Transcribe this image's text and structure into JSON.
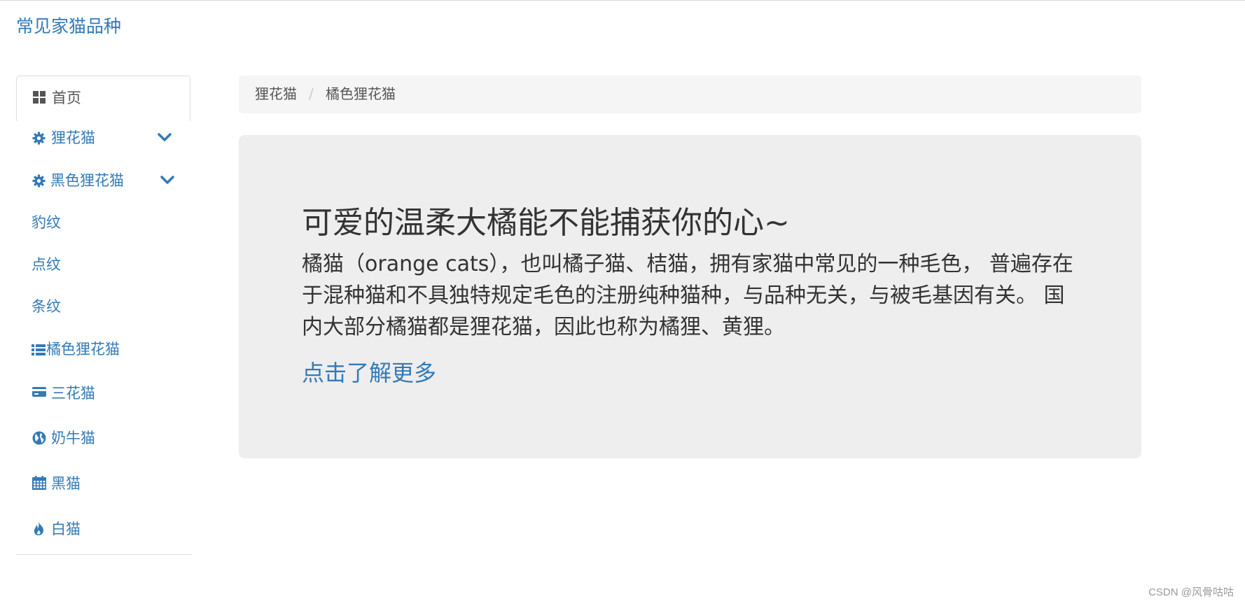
{
  "header": {
    "brand": "常见家猫品种"
  },
  "sidebar": {
    "home": {
      "label": "首页",
      "icon": "grid-icon"
    },
    "items": [
      {
        "label": "狸花猫",
        "icon": "gear-icon",
        "has_dropdown": true
      },
      {
        "label": "黑色狸花猫",
        "icon": "gear-icon",
        "has_dropdown": true
      },
      {
        "label": "豹纹",
        "icon": ""
      },
      {
        "label": "点纹",
        "icon": ""
      },
      {
        "label": "条纹",
        "icon": ""
      },
      {
        "label": "橘色狸花猫",
        "icon": "list-icon"
      },
      {
        "label": "三花猫",
        "icon": "credit-card-icon"
      },
      {
        "label": "奶牛猫",
        "icon": "globe-icon"
      },
      {
        "label": "黑猫",
        "icon": "calendar-icon"
      },
      {
        "label": "白猫",
        "icon": "fire-icon"
      }
    ]
  },
  "breadcrumb": {
    "items": [
      "狸花猫",
      "橘色狸花猫"
    ],
    "separator": "/"
  },
  "jumbotron": {
    "title": "可爱的温柔大橘能不能捕获你的心~",
    "text": "橘猫（orange cats），也叫橘子猫、桔猫，拥有家猫中常见的一种毛色， 普遍存在于混种猫和不具独特规定毛色的注册纯种猫种，与品种无关，与被毛基因有关。 国内大部分橘猫都是狸花猫，因此也称为橘狸、黄狸。",
    "link": "点击了解更多"
  },
  "watermark": "CSDN @风骨咕咕",
  "colors": {
    "link": "#337ab7",
    "jumbotron_bg": "#eeeeee",
    "breadcrumb_bg": "#f5f5f5"
  }
}
